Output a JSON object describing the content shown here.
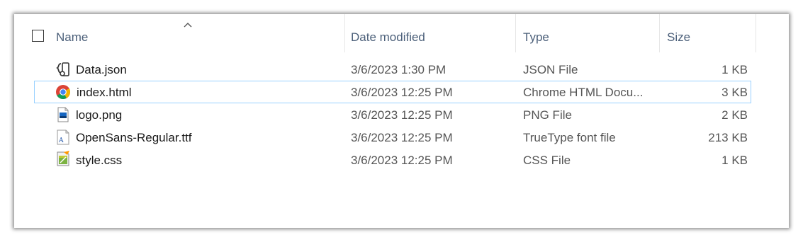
{
  "columns": {
    "name": "Name",
    "date": "Date modified",
    "type": "Type",
    "size": "Size"
  },
  "files": [
    {
      "name": "Data.json",
      "date": "3/6/2023 1:30 PM",
      "type": "JSON File",
      "size": "1 KB",
      "icon": "json-file-icon"
    },
    {
      "name": "index.html",
      "date": "3/6/2023 12:25 PM",
      "type": "Chrome HTML Docu...",
      "size": "3 KB",
      "icon": "chrome-icon"
    },
    {
      "name": "logo.png",
      "date": "3/6/2023 12:25 PM",
      "type": "PNG File",
      "size": "2 KB",
      "icon": "image-file-icon"
    },
    {
      "name": "OpenSans-Regular.ttf",
      "date": "3/6/2023 12:25 PM",
      "type": "TrueType font file",
      "size": "213 KB",
      "icon": "font-file-icon"
    },
    {
      "name": "style.css",
      "date": "3/6/2023 12:25 PM",
      "type": "CSS File",
      "size": "1 KB",
      "icon": "css-file-icon"
    }
  ]
}
